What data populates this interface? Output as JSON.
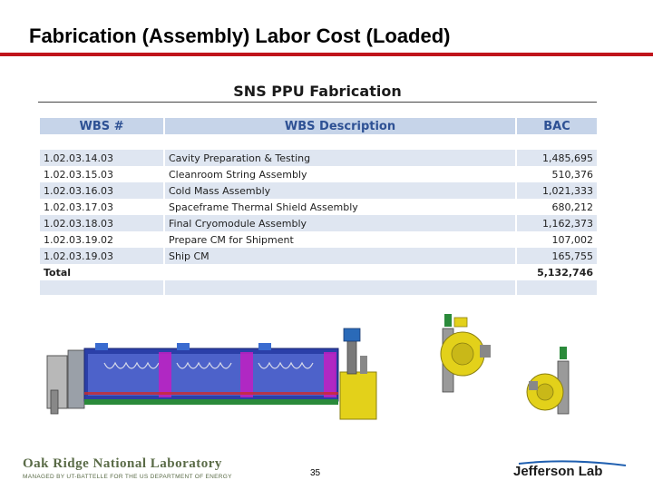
{
  "slide": {
    "title": "Fabrication (Assembly) Labor Cost (Loaded)",
    "page_number": "35"
  },
  "table": {
    "heading": "SNS PPU Fabrication",
    "columns": [
      "WBS #",
      "WBS Description",
      "BAC"
    ],
    "rows": [
      {
        "wbs": "1.02.03.14.03",
        "description": "Cavity Preparation & Testing",
        "bac": "1,485,695"
      },
      {
        "wbs": "1.02.03.15.03",
        "description": "Cleanroom String Assembly",
        "bac": "510,376"
      },
      {
        "wbs": "1.02.03.16.03",
        "description": "Cold Mass Assembly",
        "bac": "1,021,333"
      },
      {
        "wbs": "1.02.03.17.03",
        "description": "Spaceframe Thermal Shield Assembly",
        "bac": "680,212"
      },
      {
        "wbs": "1.02.03.18.03",
        "description": "Final Cryomodule Assembly",
        "bac": "1,162,373"
      },
      {
        "wbs": "1.02.03.19.02",
        "description": "Prepare CM for Shipment",
        "bac": "107,002"
      },
      {
        "wbs": "1.02.03.19.03",
        "description": "Ship CM",
        "bac": "165,755"
      }
    ],
    "total_label": "Total",
    "total_value": "5,132,746"
  },
  "footer": {
    "ornl_name": "Oak Ridge National Laboratory",
    "ornl_sub": "MANAGED BY UT-BATTELLE FOR THE US DEPARTMENT OF ENERGY",
    "jlab": "Jefferson Lab"
  },
  "colors": {
    "accent_rule": "#c0141b",
    "header_fill": "#c6d4e9",
    "header_text": "#2e5194",
    "row_band": "#dfe6f1"
  }
}
